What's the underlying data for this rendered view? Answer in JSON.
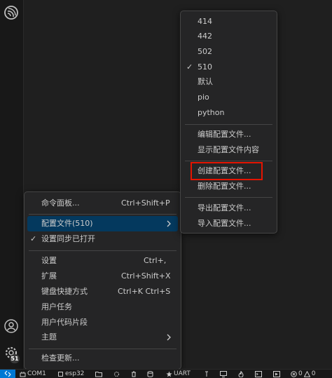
{
  "profiles_submenu": {
    "profiles": [
      {
        "label": "414",
        "checked": false
      },
      {
        "label": "442",
        "checked": false
      },
      {
        "label": "502",
        "checked": false
      },
      {
        "label": "510",
        "checked": true
      },
      {
        "label": "默认",
        "checked": false
      },
      {
        "label": "pio",
        "checked": false
      },
      {
        "label": "python",
        "checked": false
      }
    ],
    "edit_profile": "编辑配置文件...",
    "show_profile_contents": "显示配置文件内容",
    "create_profile": "创建配置文件...",
    "delete_profile": "删除配置文件...",
    "export_profile": "导出配置文件...",
    "import_profile": "导入配置文件...",
    "check_mark": "✓"
  },
  "manage_menu": {
    "command_palette": {
      "label": "命令面板...",
      "shortcut": "Ctrl+Shift+P"
    },
    "profiles": {
      "label": "配置文件(510)"
    },
    "settings_sync": {
      "label": "设置同步已打开",
      "checked": true
    },
    "settings": {
      "label": "设置",
      "shortcut": "Ctrl+,"
    },
    "extensions": {
      "label": "扩展",
      "shortcut": "Ctrl+Shift+X"
    },
    "keyboard_shortcuts": {
      "label": "键盘快捷方式",
      "shortcut": "Ctrl+K Ctrl+S"
    },
    "user_tasks": {
      "label": "用户任务"
    },
    "user_snippets": {
      "label": "用户代码片段"
    },
    "themes": {
      "label": "主题"
    },
    "check_updates": {
      "label": "检查更新..."
    }
  },
  "activity_bar": {
    "manage_badge": "51"
  },
  "status_bar": {
    "port": "COM1",
    "target": "esp32",
    "uart": "UART",
    "problems": "0",
    "warnings": "0"
  },
  "colors": {
    "highlight": "#04395e",
    "red_box": "#e51400",
    "remote": "#0078d4"
  }
}
